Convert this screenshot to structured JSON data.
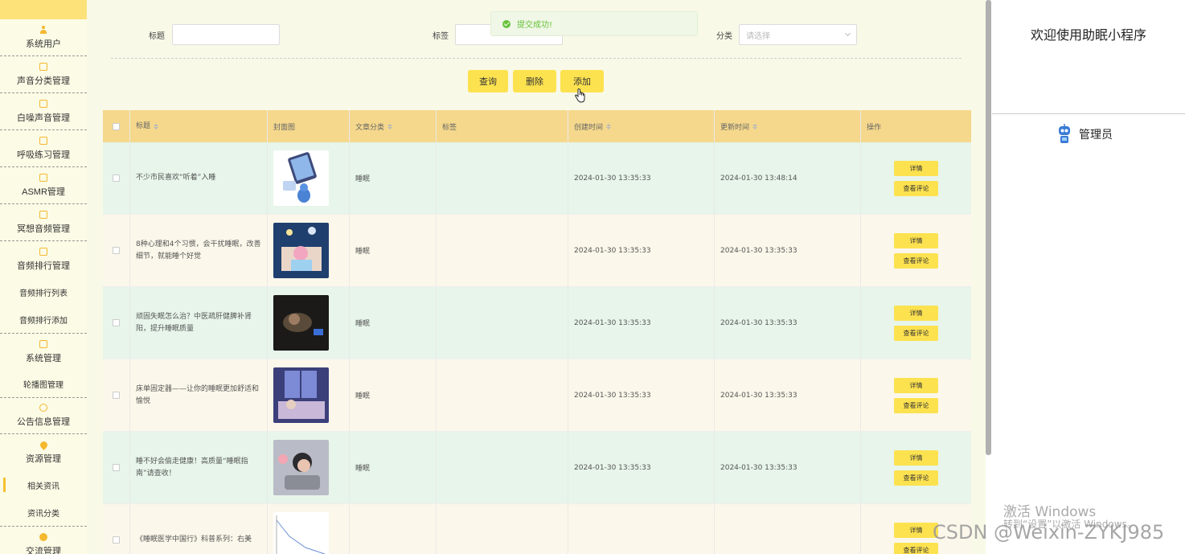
{
  "sidebar": {
    "items": [
      {
        "label": "系统用户",
        "icon": "user-icon"
      },
      {
        "label": "声音分类管理",
        "icon": "edit-icon"
      },
      {
        "label": "白噪声音管理",
        "icon": "edit-icon"
      },
      {
        "label": "呼吸练习管理",
        "icon": "edit-icon"
      },
      {
        "label": "ASMR管理",
        "icon": "edit-icon"
      },
      {
        "label": "冥想音频管理",
        "icon": "edit-icon"
      },
      {
        "label": "音频排行管理",
        "icon": "edit-icon"
      }
    ],
    "sub_rank": [
      "音频排行列表",
      "音频排行添加"
    ],
    "system": {
      "label": "系统管理",
      "icon": "image-icon"
    },
    "sub_system": [
      "轮播图管理"
    ],
    "notice": {
      "label": "公告信息管理",
      "icon": "info-icon"
    },
    "resource": {
      "label": "资源管理",
      "icon": "location-icon"
    },
    "sub_resource": [
      "相关资讯",
      "资讯分类"
    ],
    "chat": {
      "label": "交流管理",
      "icon": "chat-icon"
    }
  },
  "search": {
    "title_label": "标题",
    "tag_label": "标签",
    "category_label": "分类",
    "category_placeholder": "请选择"
  },
  "toast": {
    "text": "提交成功!"
  },
  "buttons": {
    "query": "查询",
    "delete": "删除",
    "add": "添加"
  },
  "table": {
    "headers": [
      "标题",
      "封面图",
      "文章分类",
      "标签",
      "创建时间",
      "更新时间",
      "操作"
    ],
    "detail_label": "详情",
    "comment_label": "查看评论",
    "rows": [
      {
        "title": "不少市民喜欢“听着”入睡",
        "category": "睡眠",
        "tag": "",
        "created": "2024-01-30 13:35:33",
        "updated": "2024-01-30 13:48:14",
        "cover": "phone-sleep-illustration"
      },
      {
        "title": "8种心理和4个习惯，会干扰睡眠，改善细节，就能睡个好觉",
        "category": "睡眠",
        "tag": "",
        "created": "2024-01-30 13:35:33",
        "updated": "2024-01-30 13:35:33",
        "cover": "girl-in-bed-illustration"
      },
      {
        "title": "顽固失眠怎么治？中医疏肝健脾补肾阳，提升睡眠质量",
        "category": "睡眠",
        "tag": "",
        "created": "2024-01-30 13:35:33",
        "updated": "2024-01-30 13:35:33",
        "cover": "night-sleeper-photo"
      },
      {
        "title": "床单固定器——让你的睡眠更加舒适和愉悦",
        "category": "睡眠",
        "tag": "",
        "created": "2024-01-30 13:35:33",
        "updated": "2024-01-30 13:35:33",
        "cover": "bedroom-night-photo"
      },
      {
        "title": "睡不好会偷走健康！高质量“睡眠指南”请查收！",
        "category": "睡眠",
        "tag": "",
        "created": "2024-01-30 13:35:33",
        "updated": "2024-01-30 13:35:33",
        "cover": "woman-sleeping-photo"
      },
      {
        "title": "《睡眠医学中国行》科普系列：右美",
        "category": "",
        "tag": "",
        "created": "",
        "updated": "",
        "cover": "chart-thumbnail"
      }
    ]
  },
  "right": {
    "welcome": "欢迎使用助眠小程序",
    "admin": "管理员"
  },
  "watermarks": {
    "activate": "激活 Windows",
    "activate_sub": "转到“设置”以激活 Windows。",
    "csdn": "CSDN @Weixin-ZYKJ985"
  }
}
